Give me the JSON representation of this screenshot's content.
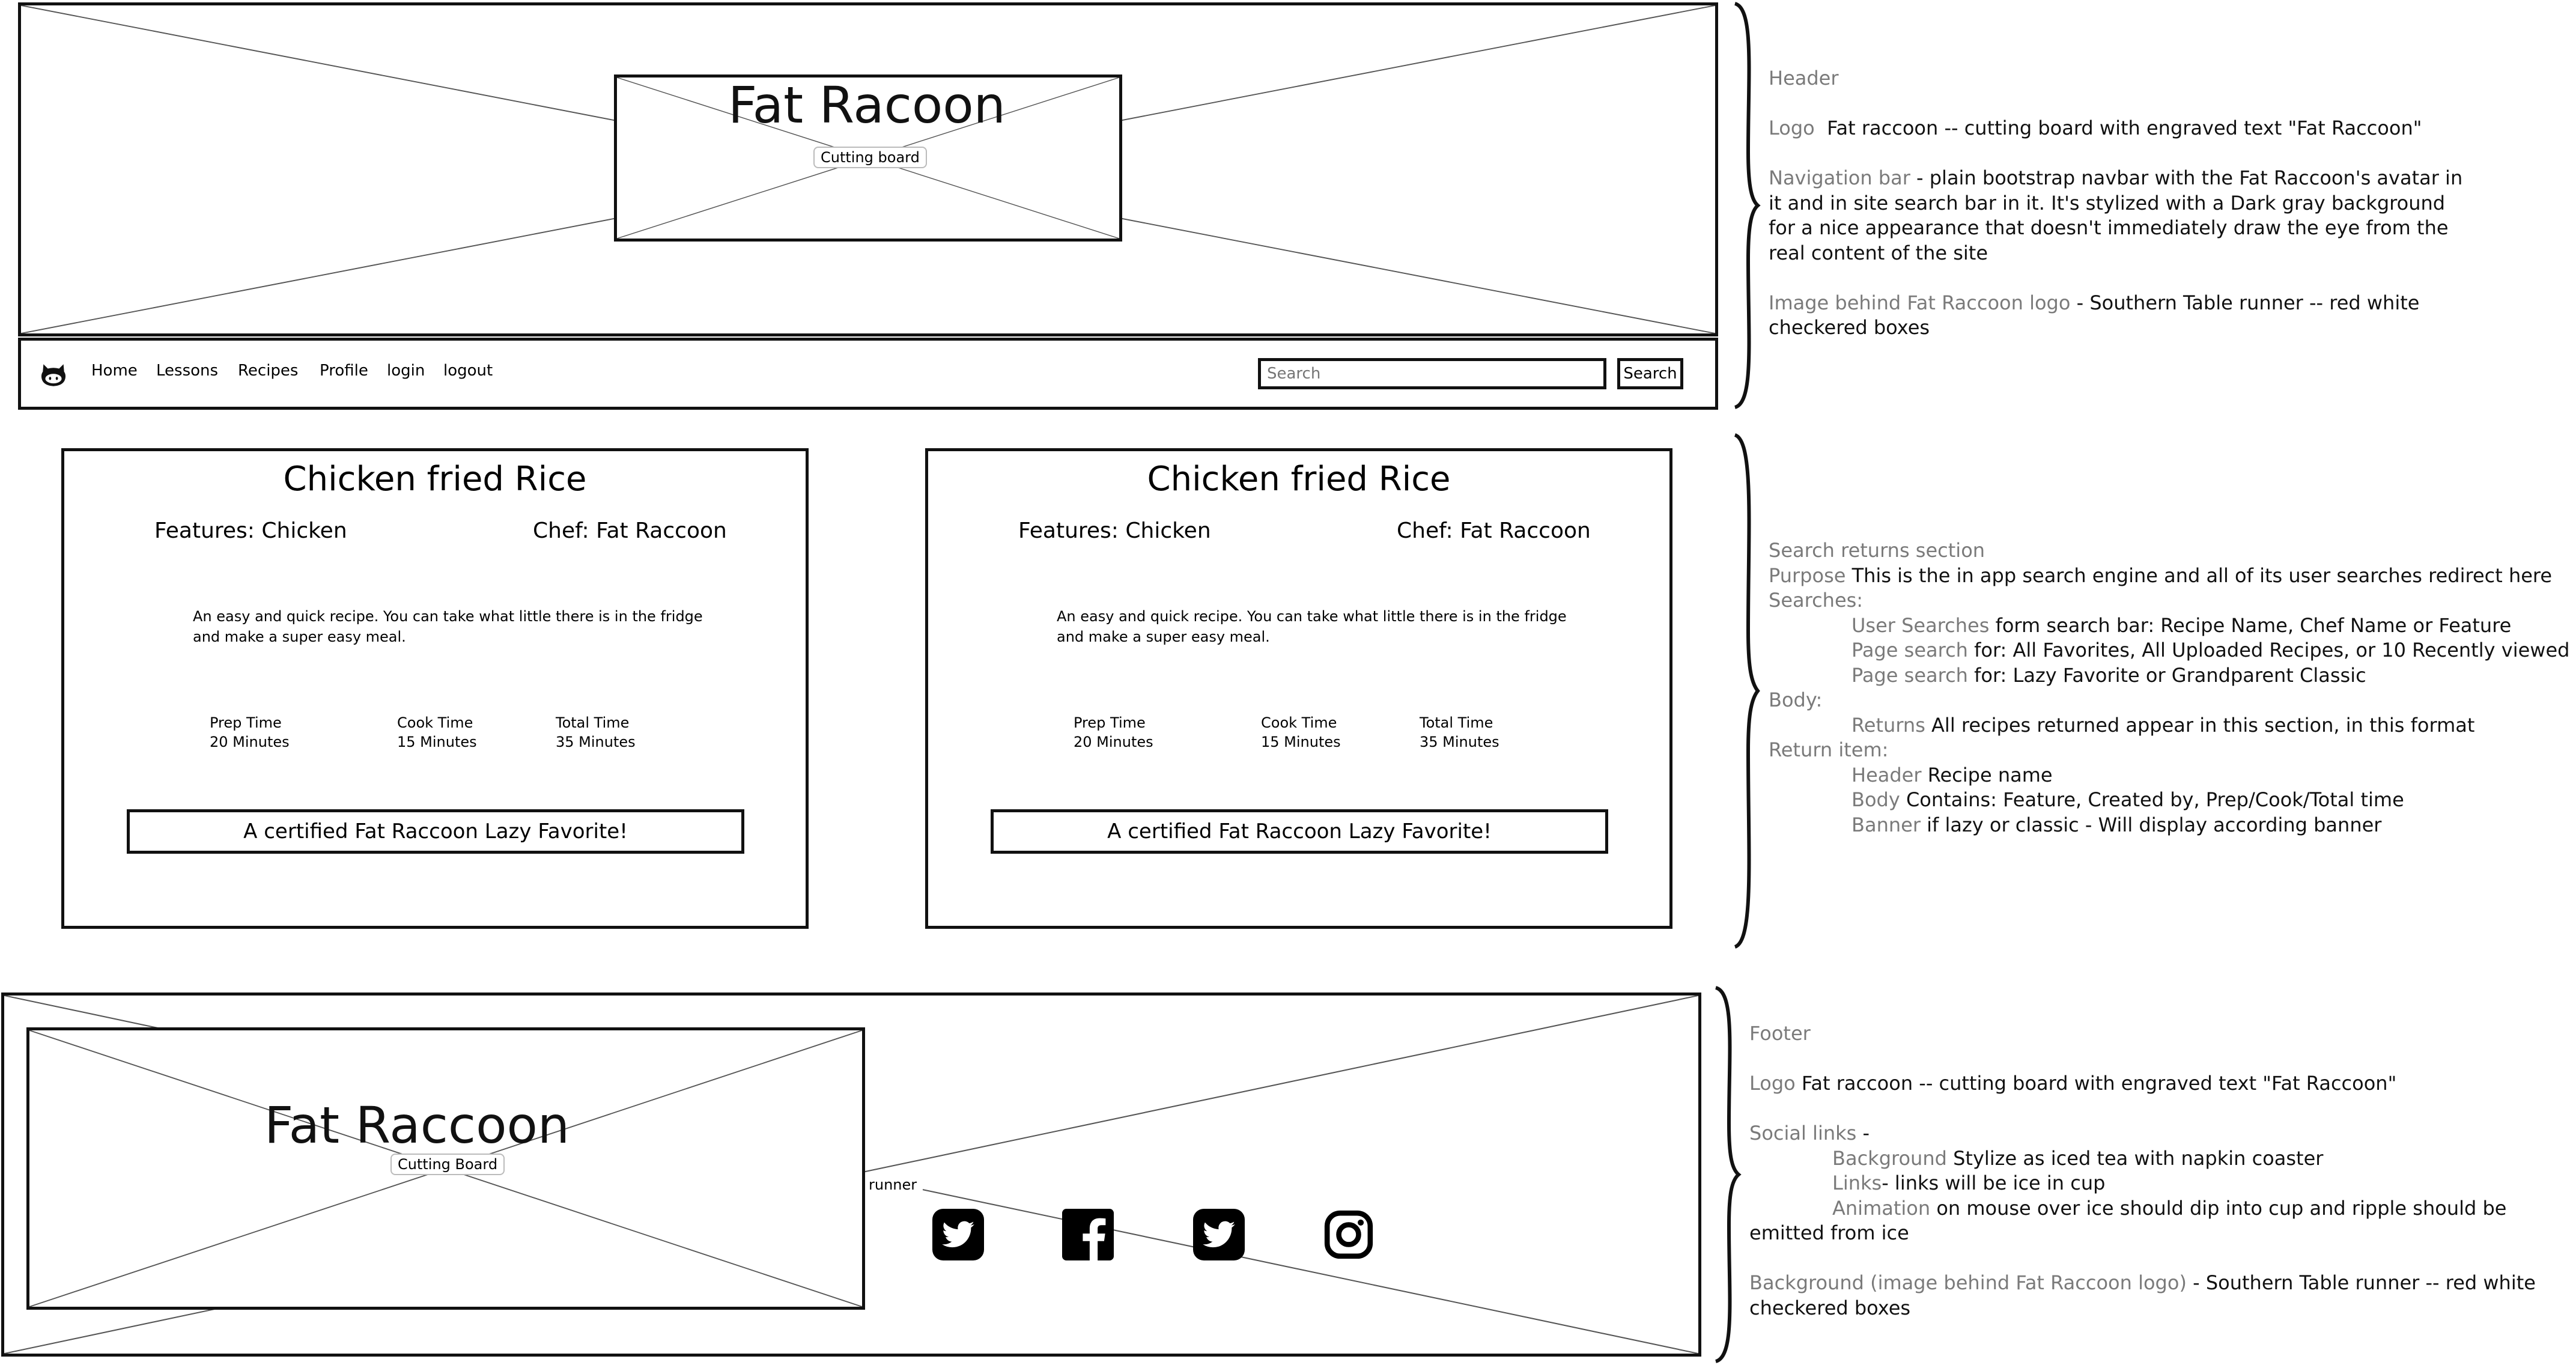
{
  "header": {
    "logo_text": "Fat Racoon",
    "logo_tag": "Cutting board"
  },
  "navbar": {
    "items": [
      "Home",
      "Lessons",
      "Recipes",
      "Profile",
      "login",
      "logout"
    ],
    "search_placeholder": "Search",
    "search_button": "Search"
  },
  "cards": [
    {
      "title": "Chicken fried Rice",
      "features": "Features: Chicken",
      "chef": "Chef: Fat Raccoon",
      "description": "An easy and quick recipe. You can take what little there is in the fridge and make a super easy meal.",
      "prep_label": "Prep Time",
      "prep_value": "20 Minutes",
      "cook_label": "Cook Time",
      "cook_value": "15 Minutes",
      "total_label": "Total Time",
      "total_value": "35 Minutes",
      "banner": "A certified Fat Raccoon Lazy Favorite!"
    },
    {
      "title": "Chicken fried Rice",
      "features": "Features: Chicken",
      "chef": "Chef: Fat Raccoon",
      "description": "An easy and quick recipe. You can take what little there is in the fridge and make a super easy meal.",
      "prep_label": "Prep Time",
      "prep_value": "20 Minutes",
      "cook_label": "Cook Time",
      "cook_value": "15 Minutes",
      "total_label": "Total Time",
      "total_value": "35 Minutes",
      "banner": "A certified Fat Raccoon Lazy Favorite!"
    }
  ],
  "footer": {
    "logo_text": "Fat Raccoon",
    "logo_tag": "Cutting Board",
    "runner_tag": "runner",
    "social_icons": [
      "twitter-icon",
      "facebook-icon",
      "twitter-icon",
      "instagram-icon"
    ]
  },
  "notes": {
    "header": {
      "title": "Header",
      "logo_label": "Logo",
      "logo_text": "Fat raccoon -- cutting board with engraved text \"Fat Raccoon\"",
      "nav_label": "Navigation bar",
      "nav_line1": " - plain bootstrap navbar with the Fat Raccoon's avatar in",
      "nav_line2": "it and  in site search bar in it.  It's stylized with a Dark gray background",
      "nav_line3": "for a nice appearance that doesn't immediately draw the eye from the",
      "nav_line4": "real content of the site",
      "img_label": "Image behind Fat Raccoon logo",
      "img_line1": " - Southern Table runner -- red white",
      "img_line2": "checkered boxes"
    },
    "search": {
      "title": "Search returns section",
      "purpose_label": "Purpose",
      "purpose_text": " This is the in app search engine and all of its user searches redirect here",
      "searches_label": "Searches:",
      "user_label": "User Searches",
      "user_text": " form search bar: Recipe Name, Chef Name or Feature",
      "page1_label": "Page search",
      "page1_text": " for: All Favorites, All Uploaded Recipes, or 10 Recently viewed",
      "page2_label": "Page search",
      "page2_text": " for: Lazy Favorite or Grandparent Classic",
      "body_label": "Body:",
      "returns_label": "Returns",
      "returns_text": " All recipes returned appear in this section, in this format",
      "item_label": "Return item:",
      "hdr_label": "Header",
      "hdr_text": " Recipe name",
      "b_label": "Body",
      "b_text": "  Contains: Feature, Created by, Prep/Cook/Total time",
      "banner_label": "Banner",
      "banner_text": " if lazy or classic - Will display according banner"
    },
    "footer": {
      "title": "Footer",
      "logo_label": "Logo",
      "logo_text": "  Fat raccoon -- cutting board with engraved text \"Fat Raccoon\"",
      "social_label": "Social links",
      "social_dash": " -",
      "bg_label": "Background",
      "bg_text": " Stylize as iced tea with napkin coaster",
      "links_label": "Links",
      "links_text": "- links will be ice in cup",
      "anim_label": "Animation",
      "anim_text": " on mouse over ice should dip into cup and ripple should be",
      "anim_text2": "emitted from ice",
      "back_label": "Background  (image behind Fat Raccoon logo)",
      "back_text": " - Southern Table runner -- red white",
      "back_text2": "checkered boxes"
    }
  }
}
